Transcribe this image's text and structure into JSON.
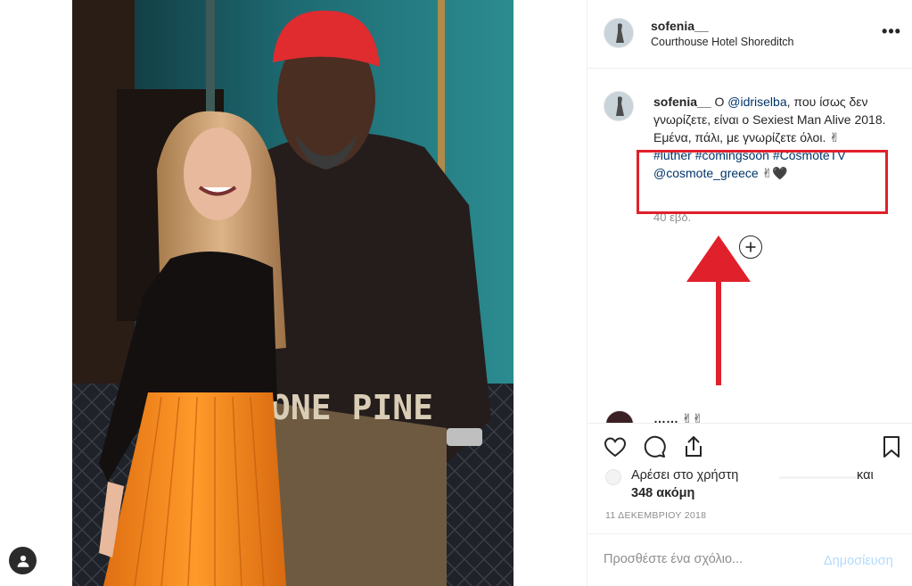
{
  "post": {
    "username": "sofenia__",
    "location": "Courthouse Hotel Shoreditch",
    "more_label": "•••"
  },
  "caption": {
    "username": "sofenia__",
    "text_1": " Ο ",
    "mention_1": "@idriselba",
    "text_2": ", που ίσως δεν γνωρίζετε, είναι ο Sexiest Man Alive 2018. Εμένα, πάλι, με γνωρίζετε όλοι. ✌",
    "hashtags": "#luther #comingsoon #CosmoteTV",
    "mention_2": "@cosmote_greece",
    "emoji": " ✌🖤",
    "time": "40 εβδ."
  },
  "comment_peek": "…… ✌✌",
  "likes": {
    "prefix": "Αρέσει στο χρήστη",
    "suffix": "και",
    "count": "348 ακόμη"
  },
  "date": "11 ΔΕΚΕΜΒΡΙΟΥ 2018",
  "comment_box": {
    "placeholder": "Προσθέστε ένα σχόλιο...",
    "post_label": "Δημοσίευση"
  },
  "photo_text": "ONE PINE",
  "colors": {
    "annotation_red": "#e0202b",
    "link_blue": "#003569",
    "post_button_disabled": "#b3dbff"
  }
}
